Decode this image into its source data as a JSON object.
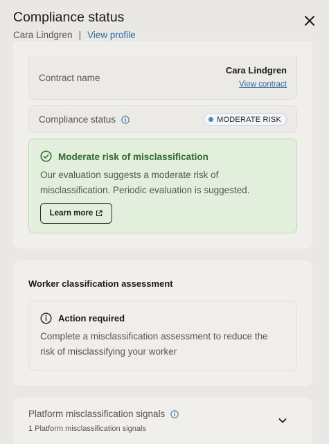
{
  "header": {
    "title": "Compliance status",
    "person_name": "Cara Lindgren",
    "separator": "|",
    "view_profile": "View profile",
    "close_icon": "close-icon"
  },
  "contract": {
    "label": "Contract name",
    "name": "Cara Lindgren",
    "link": "View contract"
  },
  "status": {
    "label": "Compliance status",
    "badge": "MODERATE RISK",
    "badge_color": "#4f86c6"
  },
  "alert": {
    "title": "Moderate risk of misclassification",
    "body": "Our evaluation suggests a moderate risk of misclassification. Periodic evaluation is suggested.",
    "button": "Learn more",
    "color": "#2f6b2a"
  },
  "assessment": {
    "section_title": "Worker classification assessment",
    "action_title": "Action required",
    "action_body": "Complete a misclassification assessment to reduce the risk of misclassifying your worker"
  },
  "signals": {
    "title": "Platform misclassification signals",
    "subtitle": "1 Platform misclassification signals"
  },
  "colors": {
    "link": "#2d6aa8",
    "background": "#e9e8e4",
    "card": "#f0efec"
  }
}
